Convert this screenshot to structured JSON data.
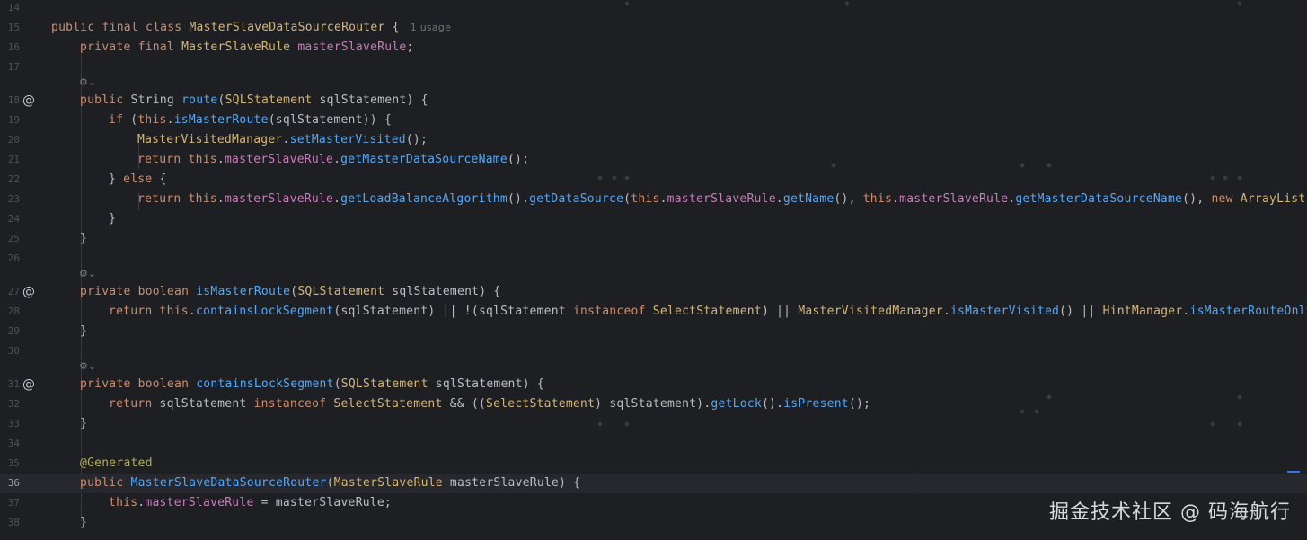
{
  "editor": {
    "lines": [
      {
        "num": "14"
      },
      {
        "num": "15",
        "usage_hint": "1 usage"
      },
      {
        "num": "16"
      },
      {
        "num": "17"
      },
      {
        "num": "18",
        "gutter": "@"
      },
      {
        "num": "19"
      },
      {
        "num": "20"
      },
      {
        "num": "21"
      },
      {
        "num": "22"
      },
      {
        "num": "23"
      },
      {
        "num": "24"
      },
      {
        "num": "25"
      },
      {
        "num": "26"
      },
      {
        "num": "27",
        "gutter": "@"
      },
      {
        "num": "28"
      },
      {
        "num": "29"
      },
      {
        "num": "30"
      },
      {
        "num": "31",
        "gutter": "@"
      },
      {
        "num": "32"
      },
      {
        "num": "33"
      },
      {
        "num": "34"
      },
      {
        "num": "35"
      },
      {
        "num": "36"
      },
      {
        "num": "37"
      },
      {
        "num": "38"
      }
    ],
    "code": {
      "l15": {
        "kw": "public final class ",
        "cls": "MasterSlaveDataSourceRouter",
        "rest": " {"
      },
      "l16": {
        "kw": "private final ",
        "cls": "MasterSlaveRule",
        "fld": "masterSlaveRule",
        "rest": ";"
      },
      "l18": {
        "kw": "public ",
        "ty": "String ",
        "mth": "route",
        "p1": "(",
        "cls": "SQLStatement",
        "prm": " sqlStatement",
        "rest": ") {"
      },
      "l19": {
        "kw": "if ",
        "p1": "(",
        "kw2": "this",
        "p2": ".",
        "mth": "isMasterRoute",
        "p3": "(sqlStatement)) {"
      },
      "l20": {
        "cls": "MasterVisitedManager",
        "p1": ".",
        "mth": "setMasterVisited",
        "rest": "();"
      },
      "l21": {
        "kw": "return ",
        "kw2": "this",
        "p1": ".",
        "fld": "masterSlaveRule",
        "p2": ".",
        "mth": "getMasterDataSourceName",
        "rest": "();"
      },
      "l22": {
        "p1": "} ",
        "kw": "else",
        "rest": " {"
      },
      "l23": {
        "kw": "return ",
        "kw2": "this",
        "p1": ".",
        "fld": "masterSlaveRule",
        "p2": ".",
        "mth": "getLoadBalanceAlgorithm",
        "p3": "().",
        "mth2": "getDataSource",
        "p4": "(",
        "kw3": "this",
        "p5": ".",
        "fld2": "masterSlaveRule",
        "p6": ".",
        "mth3": "getName",
        "p7": "(), ",
        "kw4": "this",
        "p8": ".",
        "fld3": "masterSlaveRule",
        "p9": ".",
        "mth4": "getMasterDataSourceName",
        "p10": "(), ",
        "kw5": "new ",
        "cls": "ArrayList("
      },
      "l24": {
        "rest": "}"
      },
      "l25": {
        "rest": "}"
      },
      "l27": {
        "kw": "private boolean ",
        "mth": "isMasterRoute",
        "p1": "(",
        "cls": "SQLStatement",
        "prm": " sqlStatement",
        "rest": ") {"
      },
      "l28": {
        "kw": "return ",
        "kw2": "this",
        "p1": ".",
        "mth": "containsLockSegment",
        "p2": "(sqlStatement) || !(sqlStatement ",
        "kw3": "instanceof ",
        "cls": "SelectStatement",
        "p3": ") || ",
        "cls2": "MasterVisitedManager",
        "p4": ".",
        "mth2": "isMasterVisited",
        "p5": "() || ",
        "cls3": "HintManager",
        "p6": ".",
        "mth3": "isMasterRouteOnly"
      },
      "l29": {
        "rest": "}"
      },
      "l31": {
        "kw": "private boolean ",
        "mth": "containsLockSegment",
        "p1": "(",
        "cls": "SQLStatement",
        "prm": " sqlStatement",
        "rest": ") {"
      },
      "l32": {
        "kw": "return ",
        "p1": "sqlStatement ",
        "kw2": "instanceof ",
        "cls": "SelectStatement",
        "p2": " && ((",
        "cls2": "SelectStatement",
        "p3": ") sqlStatement).",
        "mth": "getLock",
        "p4": "().",
        "mth2": "isPresent",
        "rest": "();"
      },
      "l33": {
        "rest": "}"
      },
      "l35": {
        "ann": "@Generated"
      },
      "l36": {
        "kw": "public ",
        "mth": "MasterSlaveDataSourceRouter",
        "p1": "(",
        "cls": "MasterSlaveRule",
        "prm": " masterSlaveRule",
        "rest": ") {"
      },
      "l37": {
        "kw": "this",
        "p1": ".",
        "fld": "masterSlaveRule",
        "rest": " = masterSlaveRule;"
      },
      "l38": {
        "rest": "}"
      }
    },
    "lens_icon": "ai-lens-icon",
    "lens_chevron": "⌄",
    "colors": {
      "background": "#1e1f22",
      "keyword": "#cf8e6d",
      "class": "#d5b778",
      "field": "#c77dbb",
      "method": "#56a8f5",
      "annotation": "#b3ae60",
      "line_number": "#4e5157"
    }
  },
  "watermark": {
    "text": "掘金技术社区 @ 码海航行"
  }
}
